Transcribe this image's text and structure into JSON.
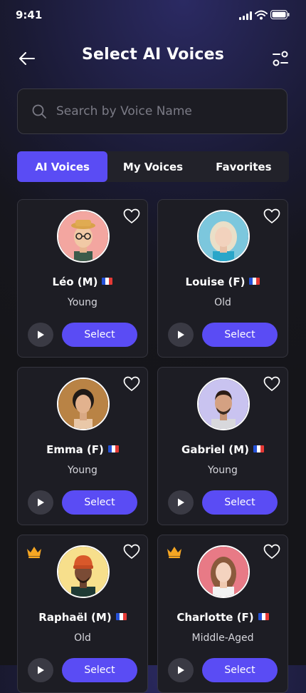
{
  "status_bar": {
    "time": "9:41"
  },
  "header": {
    "title": "Select AI Voices"
  },
  "search": {
    "placeholder": "Search by Voice Name"
  },
  "tabs": [
    {
      "label": "AI Voices",
      "active": true
    },
    {
      "label": "My Voices",
      "active": false
    },
    {
      "label": "Favorites",
      "active": false
    }
  ],
  "voices": [
    {
      "name": "Léo (M)",
      "age": "Young",
      "select_label": "Select",
      "premium": false,
      "avatar_bg": "#f3a6a0"
    },
    {
      "name": "Louise (F)",
      "age": "Old",
      "select_label": "Select",
      "premium": false,
      "avatar_bg": "#7cc7dd"
    },
    {
      "name": "Emma (F)",
      "age": "Young",
      "select_label": "Select",
      "premium": false,
      "avatar_bg": "#b98345"
    },
    {
      "name": "Gabriel (M)",
      "age": "Young",
      "select_label": "Select",
      "premium": false,
      "avatar_bg": "#c9c3f0"
    },
    {
      "name": "Raphaël (M)",
      "age": "Old",
      "select_label": "Select",
      "premium": true,
      "avatar_bg": "#f7df8c"
    },
    {
      "name": "Charlotte (F)",
      "age": "Middle-Aged",
      "select_label": "Select",
      "premium": true,
      "avatar_bg": "#e87a86"
    }
  ],
  "colors": {
    "accent": "#5a4cf4",
    "card_bg": "#1d1d24",
    "card_border": "#35353f",
    "crown": "#f5a623"
  }
}
